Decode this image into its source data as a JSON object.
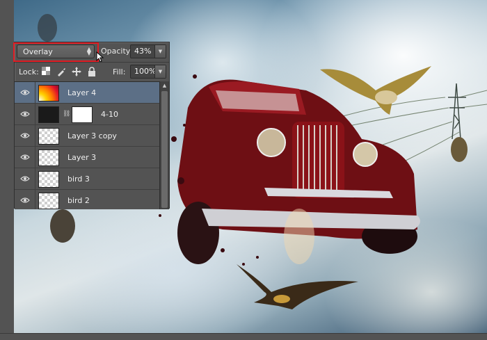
{
  "blend_mode": {
    "selected": "Overlay"
  },
  "opacity": {
    "label": "Opacity:",
    "value": "43%"
  },
  "lock": {
    "label": "Lock:",
    "icons": [
      "lock-transparent-icon",
      "lock-paint-icon",
      "lock-move-icon",
      "lock-all-icon"
    ]
  },
  "fill": {
    "label": "Fill:",
    "value": "100%"
  },
  "layers": [
    {
      "name": "Layer 4",
      "thumb": "gradient",
      "selected": true
    },
    {
      "name": "4-10",
      "thumb": "dark-with-mask",
      "selected": false
    },
    {
      "name": "Layer 3 copy",
      "thumb": "transparent",
      "selected": false
    },
    {
      "name": "Layer 3",
      "thumb": "transparent",
      "selected": false
    },
    {
      "name": "bird 3",
      "thumb": "transparent",
      "selected": false
    },
    {
      "name": "bird 2",
      "thumb": "transparent",
      "selected": false
    }
  ],
  "colors": {
    "highlight": "#e11c23",
    "selected_row": "#5c6f86",
    "panel_bg": "#535353"
  }
}
